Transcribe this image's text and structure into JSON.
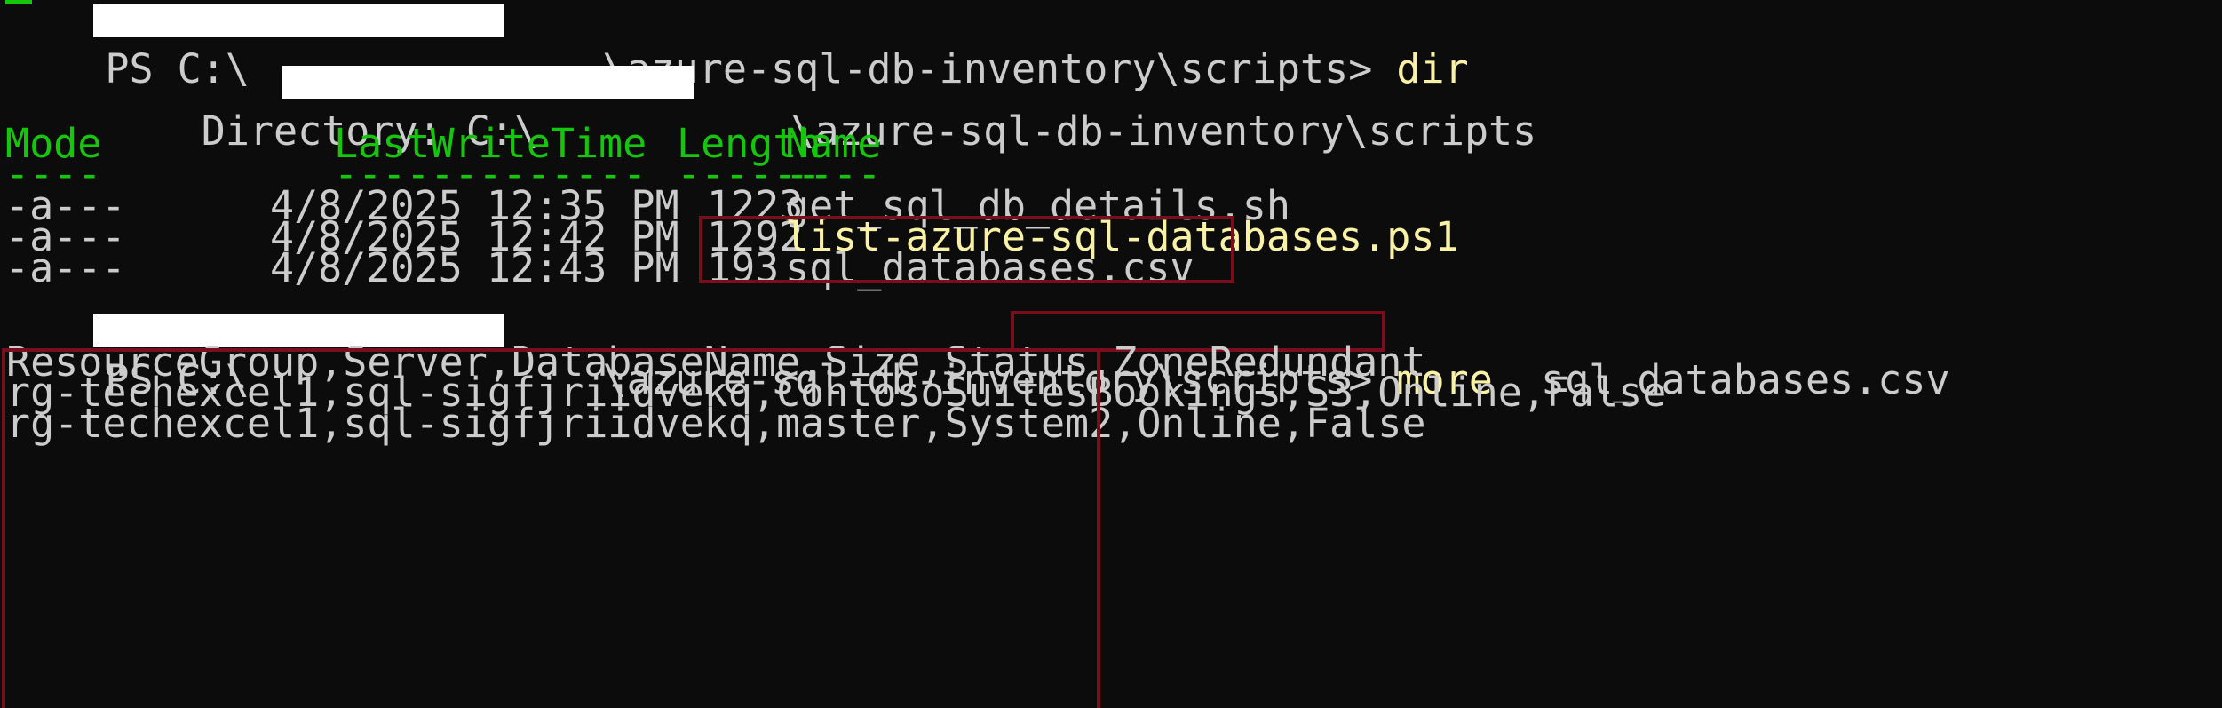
{
  "prompt1": {
    "prefix": "PS C:\\",
    "path_suffix": "\\azure-sql-db-inventory\\scripts> ",
    "command": "dir"
  },
  "directory_line": {
    "label": "    Directory: C:\\",
    "suffix": "\\azure-sql-db-inventory\\scripts"
  },
  "listing": {
    "headers": {
      "mode": "Mode",
      "lastwritetime": "LastWriteTime",
      "length": "Length",
      "name": "Name"
    },
    "underlines": {
      "mode": "----",
      "lastwritetime": "-------------",
      "length": "------",
      "name": "----"
    },
    "rows": [
      {
        "mode": "-a---",
        "date": "4/8/2025 12:35 PM",
        "length": "1223",
        "name": "get_sql_db_details.sh"
      },
      {
        "mode": "-a---",
        "date": "4/8/2025 12:42 PM",
        "length": "1292",
        "name": "list-azure-sql-databases.ps1"
      },
      {
        "mode": "-a---",
        "date": "4/8/2025 12:43 PM",
        "length": "193",
        "name": "sql_databases.csv"
      }
    ]
  },
  "prompt2": {
    "prefix": "PS C:\\",
    "path_suffix": "\\azure-sql-db-inventory\\scripts> ",
    "command": "more",
    "argument": "  sql_databases.csv"
  },
  "csv_output": [
    "ResourceGroup,Server,DatabaseName,Size,Status,ZoneRedundant",
    "rg-techexcel1,sql-sigfjriidvekq,ContosoSuitesBookings,S3,Online,False",
    "rg-techexcel1,sql-sigfjriidvekq,master,System2,Online,False"
  ],
  "colors": {
    "background": "#0c0c0c",
    "text": "#cccccc",
    "header_green": "#16c60c",
    "highlight_yellow": "#f9f1a5",
    "annotation_red": "#7a0e1c"
  }
}
